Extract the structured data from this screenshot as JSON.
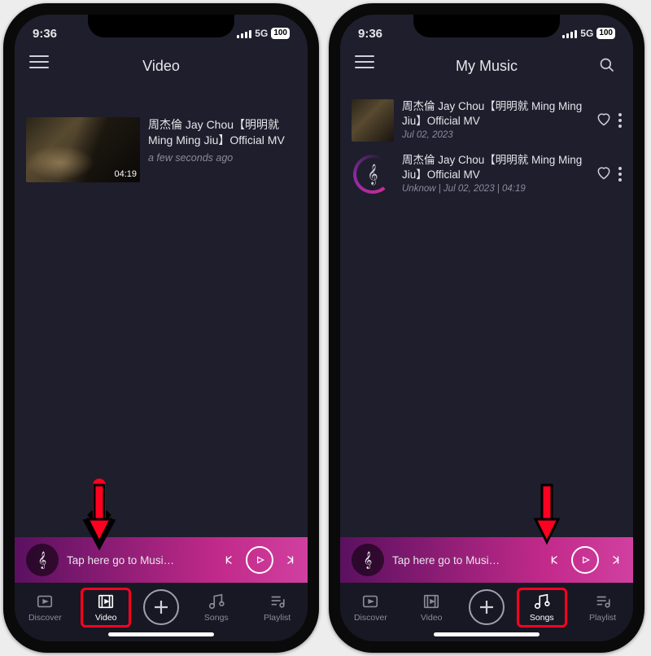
{
  "status": {
    "time": "9:36",
    "net": "5G",
    "battery": "100"
  },
  "left": {
    "title": "Video",
    "item": {
      "title": "周杰倫 Jay Chou【明明就 Ming Ming Jiu】Official MV",
      "subtitle": "a few seconds ago",
      "duration": "04:19"
    }
  },
  "right": {
    "title": "My Music",
    "items": [
      {
        "title": "周杰倫 Jay Chou【明明就 Ming Ming Jiu】Official MV",
        "subtitle": "Jul 02, 2023"
      },
      {
        "title": "周杰倫 Jay Chou【明明就 Ming Ming Jiu】Official MV",
        "subtitle": "Unknow | Jul 02, 2023 | 04:19"
      }
    ]
  },
  "mini": {
    "text": "Tap here go to Musi…"
  },
  "tabs": {
    "discover": "Discover",
    "video": "Video",
    "songs": "Songs",
    "playlist": "Playlist"
  },
  "glyph": {
    "treble": "𝄞"
  }
}
